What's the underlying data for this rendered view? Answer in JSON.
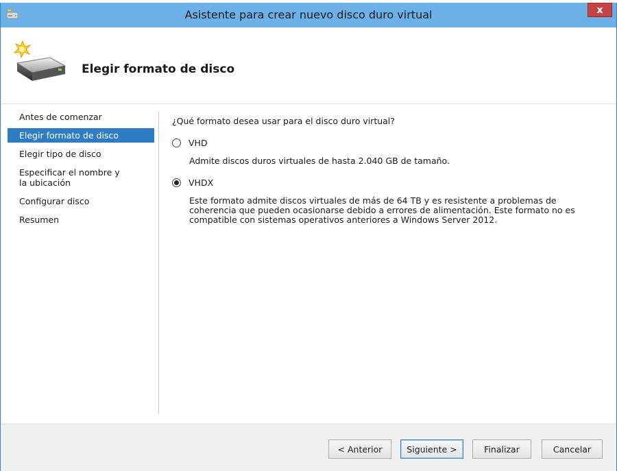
{
  "window": {
    "title": "Asistente para crear nuevo disco duro virtual",
    "close_symbol": "x"
  },
  "header": {
    "title": "Elegir formato de disco",
    "icon": "hard-disk-new-icon"
  },
  "nav": {
    "items": [
      {
        "label": "Antes de comenzar",
        "selected": false
      },
      {
        "label": "Elegir formato de disco",
        "selected": true
      },
      {
        "label": "Elegir tipo de disco",
        "selected": false
      },
      {
        "label": "Especificar el nombre y la ubicación",
        "selected": false
      },
      {
        "label": "Configurar disco",
        "selected": false
      },
      {
        "label": "Resumen",
        "selected": false
      }
    ]
  },
  "content": {
    "question": "¿Qué formato desea usar para el disco duro virtual?",
    "options": [
      {
        "label": "VHD",
        "checked": false,
        "description": "Admite discos duros virtuales de hasta 2.040 GB de tamaño."
      },
      {
        "label": "VHDX",
        "checked": true,
        "description": "Este formato admite discos virtuales de más de 64 TB y es resistente a problemas de coherencia que pueden ocasionarse debido a errores de alimentación. Este formato no es compatible con sistemas operativos anteriores a Windows Server 2012."
      }
    ]
  },
  "footer": {
    "previous": "< Anterior",
    "next": "Siguiente >",
    "finish": "Finalizar",
    "cancel": "Cancelar"
  },
  "colors": {
    "titlebar": "#6cb0e8",
    "selection": "#2e7cc4",
    "close": "#c74444"
  }
}
